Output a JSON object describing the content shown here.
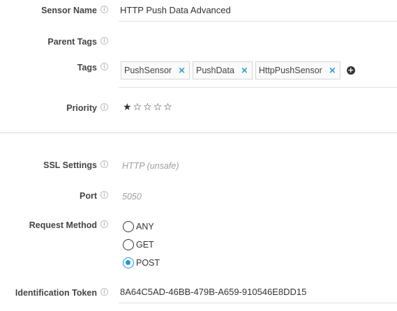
{
  "sensor_name": {
    "label": "Sensor Name",
    "value": "HTTP Push Data Advanced"
  },
  "parent_tags": {
    "label": "Parent Tags"
  },
  "tags": {
    "label": "Tags",
    "items": [
      "PushSensor",
      "PushData",
      "HttpPushSensor"
    ],
    "remove_glyph": "×",
    "add_glyph": "+"
  },
  "priority": {
    "label": "Priority",
    "value": 1,
    "max": 5
  },
  "ssl": {
    "label": "SSL Settings",
    "value": "HTTP (unsafe)"
  },
  "port": {
    "label": "Port",
    "value": "5050"
  },
  "request_method": {
    "label": "Request Method",
    "options": [
      "ANY",
      "GET",
      "POST"
    ],
    "selected": "POST"
  },
  "token": {
    "label": "Identification Token",
    "value": "8A64C5AD-46BB-479B-A659-910546E8DD15"
  },
  "icons": {
    "info": "info-icon",
    "remove": "close-icon",
    "add": "plus-circle-icon",
    "star": "star-icon"
  },
  "colors": {
    "accent": "#1a9ad6",
    "label": "#444444",
    "muted": "#9e9e9e"
  }
}
